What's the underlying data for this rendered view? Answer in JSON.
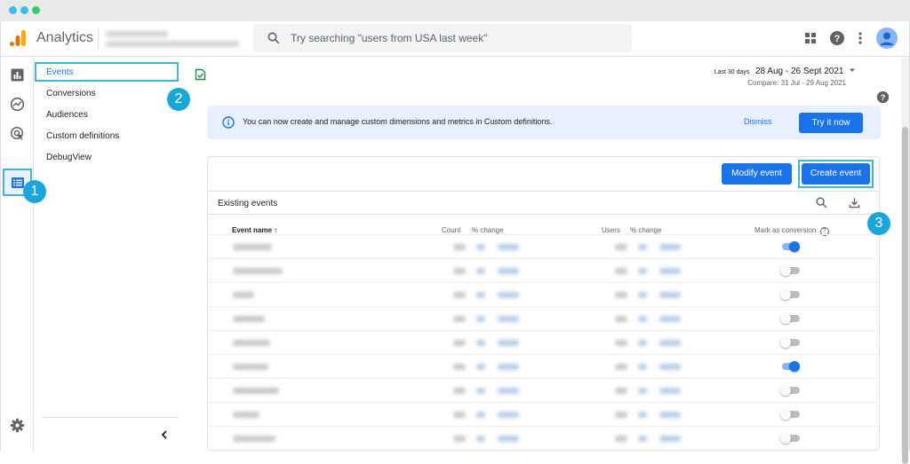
{
  "app": {
    "title": "Analytics"
  },
  "search": {
    "placeholder": "Try searching \"users from USA last week\""
  },
  "nav": {
    "items": [
      "Events",
      "Conversions",
      "Audiences",
      "Custom definitions",
      "DebugView"
    ],
    "active": "Events"
  },
  "date_range": {
    "label": "Last 30 days",
    "range": "28 Aug - 26 Sept 2021",
    "compare": "Compare: 31 Jul - 29 Aug 2021"
  },
  "banner": {
    "message": "You can now create and manage custom dimensions and metrics in Custom definitions.",
    "dismiss_label": "Dismiss",
    "try_label": "Try it now"
  },
  "events_card": {
    "modify_label": "Modify event",
    "create_label": "Create event",
    "section_title": "Existing events",
    "columns": {
      "event_name": "Event name",
      "sort_arrow": "↑",
      "count": "Count",
      "count_change": "% change",
      "users": "Users",
      "users_change": "% change",
      "mark_conversion": "Mark as conversion",
      "help": "?"
    },
    "rows_conversion": [
      true,
      false,
      false,
      false,
      false,
      true,
      false,
      false,
      false
    ]
  },
  "annotations": [
    "1",
    "2",
    "3"
  ],
  "colors": {
    "accent": "#1a73e8",
    "highlight": "#3eb5d5",
    "badge": "#1aa6d9",
    "banner_bg": "#e8f0fe"
  },
  "icons": [
    "analytics-logo-icon",
    "search-icon",
    "apps-grid-icon",
    "help-icon",
    "more-vert-icon",
    "avatar-icon",
    "reports-icon",
    "explore-icon",
    "advertising-icon",
    "configure-icon",
    "settings-icon",
    "collapse-chevron-icon",
    "info-icon",
    "download-icon",
    "saved-doc-icon"
  ]
}
